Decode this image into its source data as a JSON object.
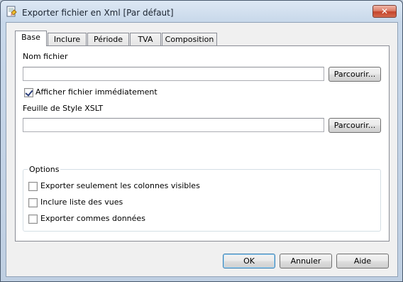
{
  "window": {
    "title": "Exporter fichier en Xml [Par défaut]"
  },
  "tabs": [
    {
      "label": "Base",
      "active": true
    },
    {
      "label": "Inclure"
    },
    {
      "label": "Période"
    },
    {
      "label": "TVA"
    },
    {
      "label": "Composition"
    }
  ],
  "base": {
    "file_name_label": "Nom fichier",
    "file_name_value": "",
    "browse_label": "Parcourir...",
    "show_file_label": "Afficher fichier immédiatement",
    "show_file_checked": true,
    "xslt_label": "Feuille de Style XSLT",
    "xslt_value": "",
    "options": {
      "title": "Options",
      "items": [
        {
          "label": "Exporter seulement les colonnes visibles",
          "checked": false
        },
        {
          "label": "Inclure liste des vues",
          "checked": false
        },
        {
          "label": "Exporter commes données",
          "checked": false
        }
      ]
    }
  },
  "footer": {
    "ok": "OK",
    "cancel": "Annuler",
    "help": "Aide"
  }
}
